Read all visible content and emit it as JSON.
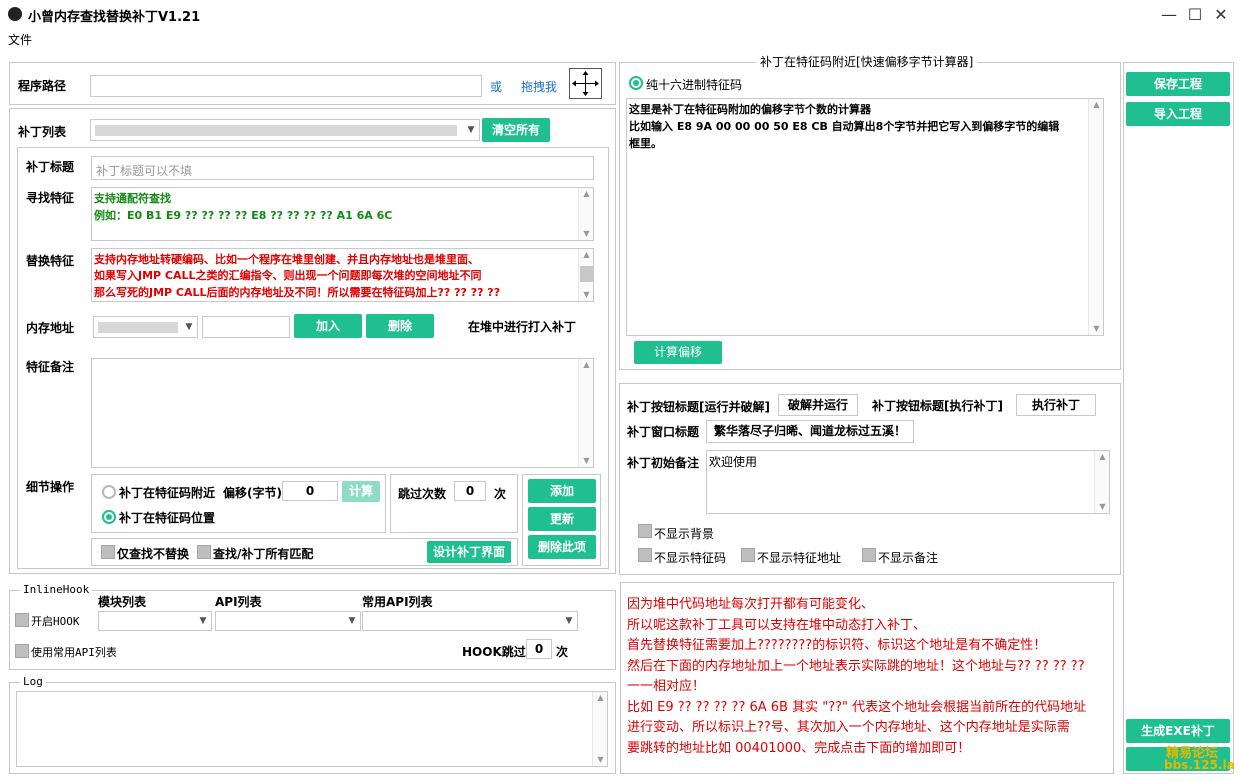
{
  "window": {
    "title": "小曾内存查找替换补丁V1.21"
  },
  "menu": {
    "file": "文件"
  },
  "path_row": {
    "label": "程序路径",
    "or": "或",
    "drag": "拖拽我"
  },
  "patch_list": {
    "label": "补丁列表",
    "clear_btn": "清空所有"
  },
  "patch_title": {
    "label": "补丁标题",
    "placeholder": "补丁标题可以不填"
  },
  "find_feature": {
    "label": "寻找特征",
    "line1": "支持通配符查找",
    "line2": "例如：E0 B1 E9 ?? ?? ?? ?? E8 ?? ?? ?? ?? A1 6A 6C"
  },
  "replace_feature": {
    "label": "替换特征",
    "line1": "支持内存地址转硬编码、比如一个程序在堆里创建、并且内存地址也是堆里面、",
    "line2": "如果写入JMP CALL之类的汇编指令、则出现一个问题即每次堆的空间地址不同",
    "line3": "那么写死的JMP CALL后面的内存地址及不同！所以需要在特征码加上?? ?? ?? ??"
  },
  "memory": {
    "label": "内存地址",
    "add_btn": "加入",
    "del_btn": "删除",
    "heap_text": "在堆中进行打入补丁"
  },
  "feature_note": {
    "label": "特征备注"
  },
  "detail": {
    "label": "细节操作",
    "near_radio": "补丁在特征码附近",
    "offset_label": "偏移(字节)",
    "offset_value": "0",
    "calc_btn": "计算",
    "at_radio": "补丁在特征码位置",
    "skip_label": "跳过次数",
    "skip_value": "0",
    "skip_unit": "次",
    "add_btn": "添加",
    "update_btn": "更新",
    "delete_btn": "删除此项",
    "only_find": "仅查找不替换",
    "find_all": "查找/补丁所有匹配",
    "design_btn": "设计补丁界面"
  },
  "inline_hook": {
    "legend": "InlineHook",
    "enable": "开启HOOK",
    "module_list": "模块列表",
    "api_list": "API列表",
    "common_api_list": "常用API列表",
    "use_common": "使用常用API列表",
    "hook_skip": "HOOK跳过",
    "hook_skip_value": "0",
    "hook_skip_unit": "次"
  },
  "log": {
    "legend": "Log"
  },
  "calculator": {
    "legend": "补丁在特征码附近[快速偏移字节计算器]",
    "hex_radio": "纯十六进制特征码",
    "line1": "这里是补丁在特征码附加的偏移字节个数的计算器",
    "line2": "比如输入 E8 9A 00 00 00 50 E8 CB 自动算出8个字节并把它写入到偏移字节的编辑",
    "line3": "框里。",
    "calc_btn": "计算偏移"
  },
  "buttons_cfg": {
    "run_label": "补丁按钮标题[运行并破解]",
    "run_value": "破解并运行",
    "exec_label": "补丁按钮标题[执行补丁]",
    "exec_value": "执行补丁",
    "window_label": "补丁窗口标题",
    "window_value": "繁华落尽子归晞、闻道龙标过五溪！",
    "note_label": "补丁初始备注",
    "note_value": "欢迎使用",
    "no_bg": "不显示背景",
    "no_feature": "不显示特征码",
    "no_addr": "不显示特征地址",
    "no_note": "不显示备注"
  },
  "info": {
    "line1": "因为堆中代码地址每次打开都有可能变化、",
    "line2": "所以呢这款补丁工具可以支持在堆中动态打入补丁、",
    "line3": "首先替换特征需要加上????????的标识符、标识这个地址是有不确定性！",
    "line4": "然后在下面的内存地址加上一个地址表示实际跳的地址！这个地址与?? ?? ?? ??",
    "line5": "一一相对应！",
    "line6": "比如 E9 ?? ?? ?? ?? 6A 6B 其实 \"??\" 代表这个地址会根据当前所在的代码地址",
    "line7": "进行变动、所以标识上??号、其次加入一个内存地址、这个内存地址是实际需",
    "line8": "要跳转的地址比如 00401000、完成点击下面的增加即可！"
  },
  "right": {
    "save_btn": "保存工程",
    "import_btn": "导入工程",
    "exe_btn": "生成EXE补丁"
  },
  "watermark": {
    "line1": "精易论坛",
    "line2": "bbs.125.la"
  }
}
